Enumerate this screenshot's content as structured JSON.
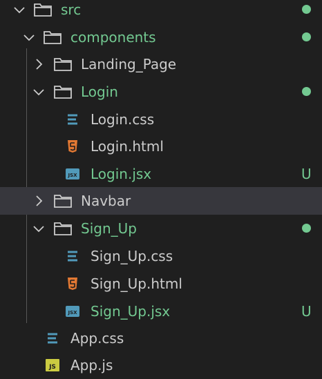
{
  "explorer": {
    "items": [
      {
        "label": "src",
        "kind": "folder",
        "expanded": true,
        "status_dot": true
      },
      {
        "label": "components",
        "kind": "folder",
        "expanded": true,
        "status_dot": true
      },
      {
        "label": "Landing_Page",
        "kind": "folder",
        "expanded": false
      },
      {
        "label": "Login",
        "kind": "folder",
        "expanded": true,
        "status_dot": true
      },
      {
        "label": "Login.css",
        "kind": "css-file"
      },
      {
        "label": "Login.html",
        "kind": "html-file"
      },
      {
        "label": "Login.jsx",
        "kind": "jsx-file",
        "badge": "U"
      },
      {
        "label": "Navbar",
        "kind": "folder",
        "expanded": false,
        "selected": true
      },
      {
        "label": "Sign_Up",
        "kind": "folder",
        "expanded": true,
        "status_dot": true
      },
      {
        "label": "Sign_Up.css",
        "kind": "css-file"
      },
      {
        "label": "Sign_Up.html",
        "kind": "html-file"
      },
      {
        "label": "Sign_Up.jsx",
        "kind": "jsx-file",
        "badge": "U"
      },
      {
        "label": "App.css",
        "kind": "css-file"
      },
      {
        "label": "App.js",
        "kind": "js-file"
      }
    ]
  },
  "icons": {
    "css": {
      "text": "JSX",
      "color": "#519aba"
    },
    "html_color": "#e37933",
    "jsx": {
      "text": "JSX",
      "color": "#519aba"
    },
    "js": {
      "text": "JS",
      "color": "#cbcb41"
    }
  },
  "colors": {
    "background": "#1f1f1f",
    "text": "#cccccc",
    "git_added": "#73c991",
    "selected_row": "#37373d"
  }
}
